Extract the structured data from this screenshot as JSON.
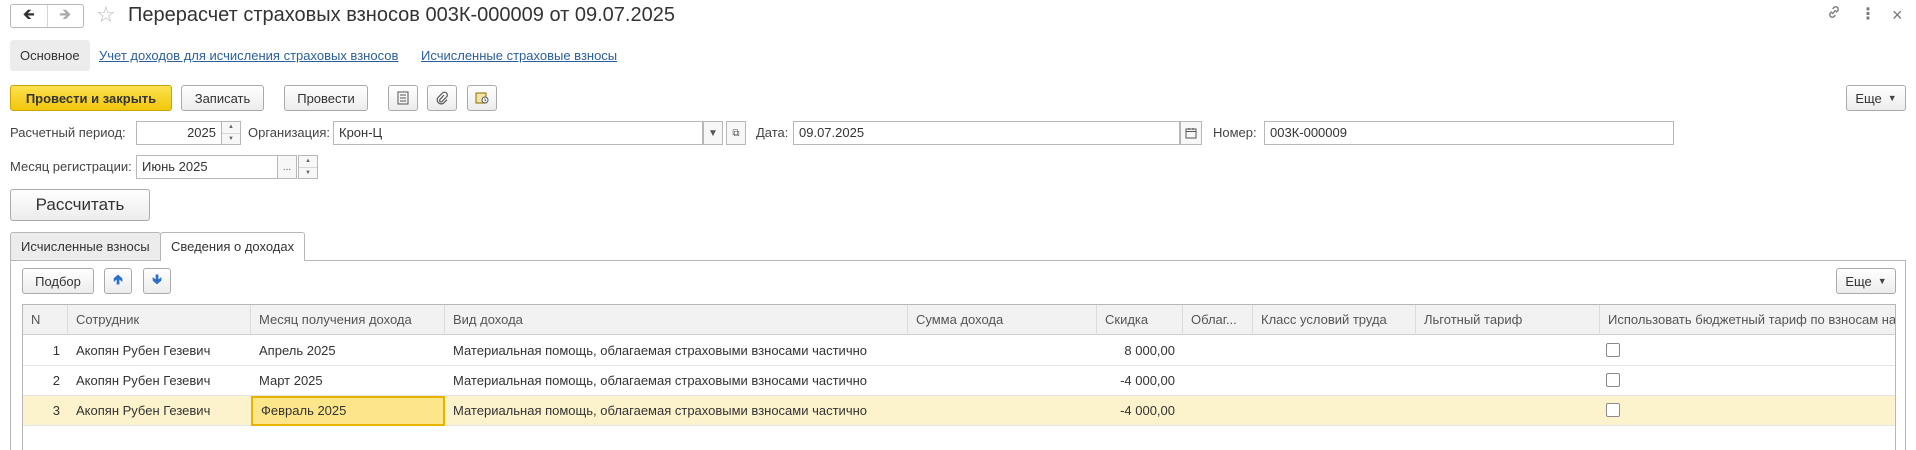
{
  "window": {
    "title": "Перерасчет страховых взносов 003К-000009 от 09.07.2025",
    "back_icon": "arrow-left-icon",
    "forward_icon": "arrow-right-icon",
    "star_icon": "star-icon",
    "link_icon": "link-icon",
    "menu_icon": "more-vertical-icon",
    "close_icon": "close-icon"
  },
  "sections": {
    "main": "Основное",
    "income": "Учет доходов для исчисления страховых взносов",
    "calculated": "Исчисленные страховые взносы"
  },
  "toolbar": {
    "post_close": "Провести и закрыть",
    "save": "Записать",
    "post": "Провести",
    "more": "Еще"
  },
  "form": {
    "period_label": "Расчетный период:",
    "period_value": "2025",
    "org_label": "Организация:",
    "org_value": "Крон-Ц",
    "date_label": "Дата:",
    "date_value": "09.07.2025",
    "number_label": "Номер:",
    "number_value": "003К-000009",
    "reg_month_label": "Месяц регистрации:",
    "reg_month_value": "Июнь 2025",
    "calc_button": "Рассчитать"
  },
  "tabs": [
    {
      "label": "Исчисленные взносы",
      "active": false
    },
    {
      "label": "Сведения о доходах",
      "active": true
    }
  ],
  "table_toolbar": {
    "select": "Подбор",
    "more": "Еще"
  },
  "table": {
    "columns": [
      "N",
      "Сотрудник",
      "Месяц получения дохода",
      "Вид дохода",
      "Сумма дохода",
      "Скидка",
      "Облаг...",
      "Класс условий труда",
      "Льготный тариф",
      "Использовать бюджетный тариф по взносам на НС"
    ],
    "rows": [
      {
        "n": "1",
        "employee": "Акопян Рубен Гезевич",
        "month": "Апрель 2025",
        "type": "Материальная помощь, облагаемая страховыми взносами частично",
        "sum": "",
        "discount": "8 000,00"
      },
      {
        "n": "2",
        "employee": "Акопян Рубен Гезевич",
        "month": "Март 2025",
        "type": "Материальная помощь, облагаемая страховыми взносами частично",
        "sum": "",
        "discount": "-4 000,00"
      },
      {
        "n": "3",
        "employee": "Акопян Рубен Гезевич",
        "month": "Февраль 2025",
        "type": "Материальная помощь, облагаемая страховыми взносами частично",
        "sum": "",
        "discount": "-4 000,00"
      }
    ]
  },
  "colors": {
    "primary_button": "#f2c60b",
    "selected_row": "#fcf3cc",
    "link": "#2a5f9b"
  }
}
